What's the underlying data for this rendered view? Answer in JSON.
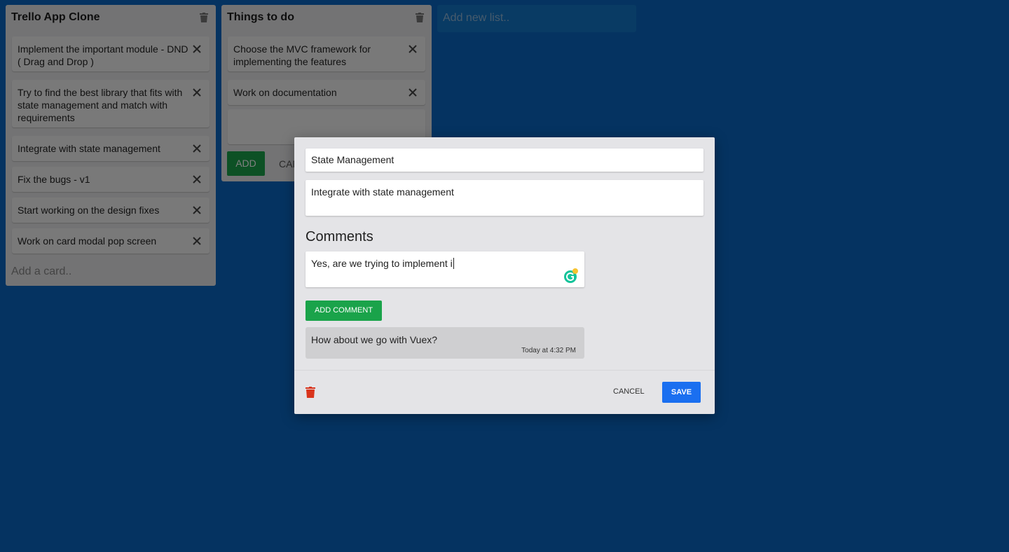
{
  "board": {
    "lists": [
      {
        "title": "Trello App Clone",
        "cards": [
          "Implement the important module - DND ( Drag and Drop )",
          "Try to find the best library that fits with state management and match with requirements",
          "Integrate with state management",
          "Fix the bugs - v1",
          "Start working on the design fixes",
          "Work on card modal pop screen"
        ],
        "add_card_placeholder": "Add a card.."
      },
      {
        "title": "Things to do",
        "cards": [
          "Choose the MVC framework for implementing the features",
          "Work on documentation"
        ],
        "add_label": "ADD",
        "cancel_label": "CANCEL"
      }
    ],
    "new_list_placeholder": "Add new list.."
  },
  "modal": {
    "card_title": "State Management",
    "card_description": "Integrate with state management",
    "comments_heading": "Comments",
    "comment_draft": "Yes, are we trying to implement i",
    "add_comment_label": "ADD COMMENT",
    "comments": [
      {
        "text": "How about we go with Vuex?",
        "time": "Today at 4:32 PM"
      }
    ],
    "cancel_label": "CANCEL",
    "save_label": "SAVE"
  },
  "colors": {
    "background": "#0a66c2",
    "list": "#e6e6e8",
    "add_button": "#1aa34a",
    "save_button": "#1a6ff0",
    "delete_icon": "#d9341c"
  }
}
